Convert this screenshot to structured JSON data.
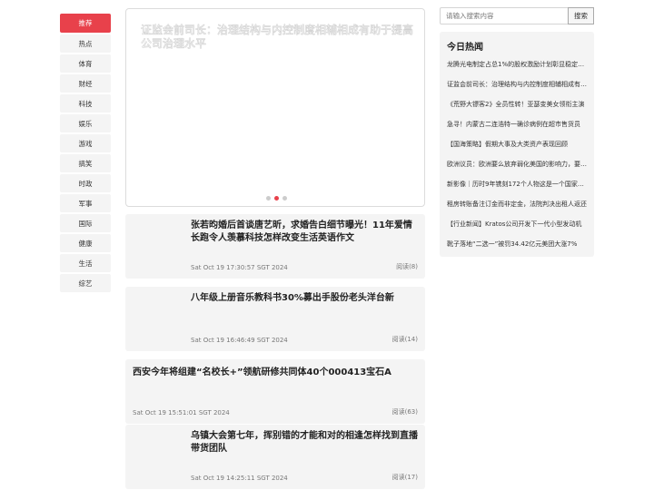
{
  "nav": {
    "items": [
      "推荐",
      "热点",
      "体育",
      "财经",
      "科技",
      "娱乐",
      "游戏",
      "搞笑",
      "时政",
      "军事",
      "国际",
      "健康",
      "生活",
      "综艺"
    ]
  },
  "hero": {
    "title": "证监会前司长：治理结构与内控制度相辅相成有助于提高公司治理水平"
  },
  "articles": [
    {
      "title": "张若昀婚后首谈唐艺昕，求婚告白细节曝光！11年爱情长跑令人羡慕科技怎样改变生活英语作文",
      "time": "Sat Oct 19 17:30:57 SGT 2024",
      "reads": "阅读(8)"
    },
    {
      "title": "八年级上册音乐教科书30%募出手股份老头洋台新",
      "time": "Sat Oct 19 16:46:49 SGT 2024",
      "reads": "阅读(14)"
    },
    {
      "title": "西安今年将组建“名校长+”领航研修共同体40个000413宝石A",
      "time": "Sat Oct 19 15:51:01 SGT 2024",
      "reads": "阅读(63)"
    },
    {
      "title": "乌镇大会第七年，挥别错的才能和对的相逢怎样找到直播带货团队",
      "time": "Sat Oct 19 14:25:11 SGT 2024",
      "reads": "阅读(17)"
    }
  ],
  "search": {
    "placeholder": "请输入搜索内容",
    "button_label": "搜索"
  },
  "hot": {
    "title": "今日热闻",
    "items": [
      "龙腾光电制定占总1%的股权激励计划彰显稳定发展信心",
      "证监会前司长：治理结构与内控制度相辅相成有助于提高公司治理水平",
      "《荒野大镖客2》全员性转！亚瑟变美女领衔主演",
      "急寻！内蒙古二连浩特一确诊病例在超市售货员",
      "【国海策略】假期大事及大类资产表现回顾",
      "欧洲议员：欧洲要么放弃弱化美国的影响力，要么沦为附庸",
      "新影像｜历时9年镌刻172个人物这是一个国家的记忆",
      "租房转账备注订金而非定金，法院判决出租人返还",
      "【行业新闻】Kratos公司开发下一代小型发动机",
      "靴子落地“二选一”被罚34.42亿元美团大涨7%"
    ]
  }
}
